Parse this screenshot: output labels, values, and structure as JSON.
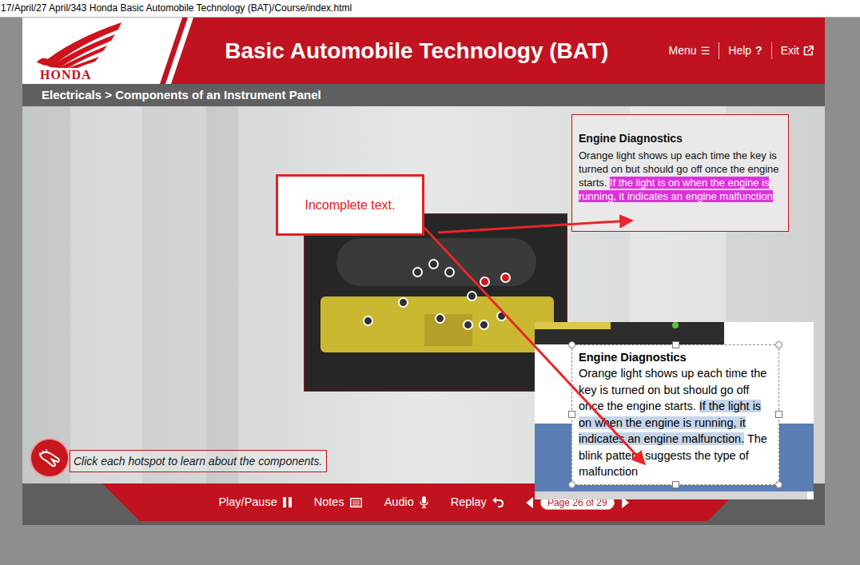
{
  "address_bar": {
    "path": "17/April/27 April/343 Honda Basic Automobile Technology (BAT)/Course/index.html"
  },
  "header": {
    "logo": "HONDA",
    "title": "Basic Automobile Technology (BAT)",
    "nav": [
      {
        "label": "Menu",
        "glyph": "☰"
      },
      {
        "label": "Help",
        "glyph": "?"
      },
      {
        "label": "Exit"
      }
    ]
  },
  "breadcrumb": "Electricals > Components of an Instrument Panel",
  "hotspots": [
    {
      "color": "#2f2f2f"
    },
    {
      "color": "#2f2f2f"
    },
    {
      "color": "#2f2f2f"
    },
    {
      "color": "#d3151c"
    },
    {
      "color": "#d3151c"
    },
    {
      "color": "#2f2f2f"
    },
    {
      "color": "#2f2f2f"
    },
    {
      "color": "#2f2f2f"
    },
    {
      "color": "#2f2f2f"
    },
    {
      "color": "#2f2f2f"
    },
    {
      "color": "#2f2f2f"
    },
    {
      "color": "#2f2f2f"
    }
  ],
  "popup": {
    "title": "Engine Diagnostics",
    "text": "Orange light shows up each time the key is turned on but should go off once the engine starts. ",
    "highlighted": "If the light is on when the engine is running, it indicates an engine malfunction"
  },
  "annotation": {
    "text": "Incomplete text."
  },
  "reference_screenshot": {
    "title": "Engine Diagnostics",
    "text": "Orange light shows up each time the key is turned on but should go off once the engine starts. ",
    "selected": "If the light is on when the engine is running, it indicates an engine malfunction.",
    "rest": " The blink pattern suggests the type of malfunction"
  },
  "instruction": "Click each hotspot to learn about the components.",
  "footer": {
    "controls": [
      {
        "label": "Play/Pause"
      },
      {
        "label": "Notes"
      },
      {
        "label": "Audio"
      },
      {
        "label": "Replay"
      }
    ],
    "page": "Page 26 of 29"
  }
}
